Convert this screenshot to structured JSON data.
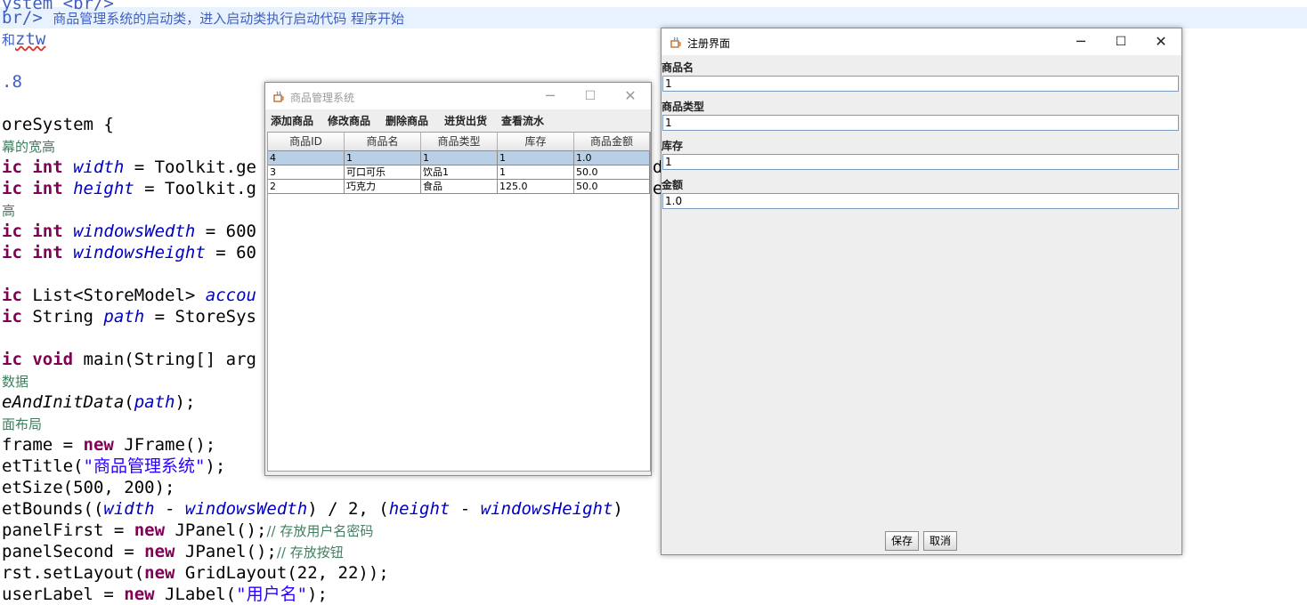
{
  "editor": {
    "lines": [
      {
        "parts": [
          [
            "doc",
            "ystem <br/>"
          ]
        ]
      },
      {
        "parts": [
          [
            "doc",
            "br/> "
          ],
          [
            "doccn",
            "商品管理系统的启动类，进入启动类执行启动代码 程序开始"
          ]
        ]
      },
      {
        "parts": [
          [
            "doccn",
            "和"
          ],
          [
            "docsq",
            "ztw"
          ]
        ]
      },
      {
        "parts": []
      },
      {
        "parts": [
          [
            "doc",
            ".8"
          ]
        ]
      },
      {
        "parts": []
      },
      {
        "parts": [
          [
            "pl",
            "oreSystem {"
          ]
        ]
      },
      {
        "parts": [
          [
            "cmt",
            "幕的宽高"
          ]
        ]
      },
      {
        "parts": [
          [
            "kw",
            "ic int "
          ],
          [
            "fld",
            "width"
          ],
          [
            "pl",
            " = Toolkit.ge"
          ]
        ]
      },
      {
        "parts": [
          [
            "kw",
            "ic int "
          ],
          [
            "fld",
            "height"
          ],
          [
            "pl",
            " = Toolkit.g"
          ]
        ]
      },
      {
        "parts": [
          [
            "cmt",
            "高"
          ]
        ]
      },
      {
        "parts": [
          [
            "kw",
            "ic int "
          ],
          [
            "fld",
            "windowsWedth"
          ],
          [
            "pl",
            " = 600"
          ]
        ]
      },
      {
        "parts": [
          [
            "kw",
            "ic int "
          ],
          [
            "fld",
            "windowsHeight"
          ],
          [
            "pl",
            " = 60"
          ]
        ]
      },
      {
        "parts": []
      },
      {
        "parts": [
          [
            "kw",
            "ic "
          ],
          [
            "pl",
            "List<StoreModel> "
          ],
          [
            "fld",
            "accou"
          ]
        ]
      },
      {
        "parts": [
          [
            "kw",
            "ic "
          ],
          [
            "pl",
            "String "
          ],
          [
            "fld",
            "path"
          ],
          [
            "pl",
            " = StoreSys"
          ]
        ]
      },
      {
        "parts": []
      },
      {
        "parts": [
          [
            "kw",
            "ic void "
          ],
          [
            "pl",
            "main(String[] arg"
          ]
        ]
      },
      {
        "parts": [
          [
            "cmt",
            "数据"
          ]
        ]
      },
      {
        "parts": [
          [
            "mth",
            "eAndInitData"
          ],
          [
            "pl",
            "("
          ],
          [
            "fld",
            "path"
          ],
          [
            "pl",
            ");"
          ]
        ]
      },
      {
        "parts": [
          [
            "cmt",
            "面布局"
          ]
        ]
      },
      {
        "parts": [
          [
            "pl",
            "frame = "
          ],
          [
            "kw",
            "new "
          ],
          [
            "pl",
            "JFrame();"
          ]
        ]
      },
      {
        "parts": [
          [
            "pl",
            "etTitle("
          ],
          [
            "str",
            "\"商品管理系统\""
          ],
          [
            "pl",
            ");"
          ]
        ]
      },
      {
        "parts": [
          [
            "pl",
            "etSize(500, 200);"
          ]
        ]
      },
      {
        "parts": [
          [
            "pl",
            "etBounds(("
          ],
          [
            "fld",
            "width"
          ],
          [
            "pl",
            " - "
          ],
          [
            "fld",
            "windowsWedth"
          ],
          [
            "pl",
            ") / 2, ("
          ],
          [
            "fld",
            "height"
          ],
          [
            "pl",
            " - "
          ],
          [
            "fld",
            "windowsHeight"
          ],
          [
            "pl",
            ")"
          ]
        ]
      },
      {
        "parts": [
          [
            "pl",
            "panelFirst = "
          ],
          [
            "kw",
            "new "
          ],
          [
            "pl",
            "JPanel();"
          ],
          [
            "cmt",
            "// 存放用户名密码"
          ]
        ]
      },
      {
        "parts": [
          [
            "pl",
            "panelSecond = "
          ],
          [
            "kw",
            "new "
          ],
          [
            "pl",
            "JPanel();"
          ],
          [
            "cmt",
            "// 存放按钮"
          ]
        ]
      },
      {
        "parts": [
          [
            "pl",
            "rst.setLayout("
          ],
          [
            "kw",
            "new "
          ],
          [
            "pl",
            "GridLayout(22, 22));"
          ]
        ]
      },
      {
        "parts": [
          [
            "pl",
            "userLabel = "
          ],
          [
            "kw",
            "new "
          ],
          [
            "pl",
            "JLabel("
          ],
          [
            "str",
            "\"用户名\""
          ],
          [
            "pl",
            ");"
          ]
        ]
      }
    ],
    "right_fragments": [
      "d",
      "e"
    ]
  },
  "store_window": {
    "title": "商品管理系统",
    "menu": [
      "添加商品",
      "修改商品",
      "删除商品",
      "进货出货",
      "查看流水"
    ],
    "columns": [
      "商品ID",
      "商品名",
      "商品类型",
      "库存",
      "商品金额"
    ],
    "rows": [
      [
        "4",
        "1",
        "1",
        "1",
        "1.0"
      ],
      [
        "3",
        "可口可乐",
        "饮品1",
        "1",
        "50.0"
      ],
      [
        "2",
        "巧克力",
        "食品",
        "125.0",
        "50.0"
      ]
    ],
    "selected_row": 0
  },
  "register_window": {
    "title": "注册界面",
    "fields": [
      {
        "label": "商品名",
        "value": "1"
      },
      {
        "label": "商品类型",
        "value": "1"
      },
      {
        "label": "库存",
        "value": "1"
      },
      {
        "label": "金额",
        "value": "1.0"
      }
    ],
    "save_label": "保存",
    "cancel_label": "取消"
  },
  "window_controls": {
    "minimize": "─",
    "maximize": "☐",
    "close": "✕"
  },
  "colors": {
    "highlight_line": "#e8f2fe",
    "keyword": "#7f0055",
    "field": "#0000c0",
    "comment": "#3f7f5f",
    "javadoc": "#3f5fbf",
    "selection": "#b8cfe5"
  }
}
